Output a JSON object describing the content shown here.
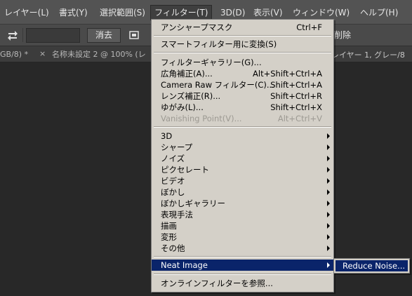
{
  "menubar": {
    "items": [
      {
        "label": "レイヤー(L)"
      },
      {
        "label": "書式(Y)"
      },
      {
        "label": "選択範囲(S)"
      },
      {
        "label": "フィルター(T)"
      },
      {
        "label": "3D(D)"
      },
      {
        "label": "表示(V)"
      },
      {
        "label": "ウィンドウ(W)"
      },
      {
        "label": "ヘルプ(H)"
      }
    ]
  },
  "optionsbar": {
    "clear_label": "消去",
    "right_text": "削除"
  },
  "tabs": {
    "left": "GB/8) *",
    "close": "×",
    "second": "名称未設定 2 @ 100% (レ",
    "right": "レイヤー 1, グレー/8"
  },
  "filter_menu": {
    "items": [
      {
        "label": "アンシャープマスク",
        "shortcut": "Ctrl+F"
      },
      {
        "label": "スマートフィルター用に変換(S)"
      },
      {
        "label": "フィルターギャラリー(G)..."
      },
      {
        "label": "広角補正(A)...",
        "shortcut": "Alt+Shift+Ctrl+A"
      },
      {
        "label": "Camera Raw フィルター(C)...",
        "shortcut": "Shift+Ctrl+A"
      },
      {
        "label": "レンズ補正(R)...",
        "shortcut": "Shift+Ctrl+R"
      },
      {
        "label": "ゆがみ(L)...",
        "shortcut": "Shift+Ctrl+X"
      },
      {
        "label": "Vanishing Point(V)...",
        "shortcut": "Alt+Ctrl+V"
      },
      {
        "label": "3D"
      },
      {
        "label": "シャープ"
      },
      {
        "label": "ノイズ"
      },
      {
        "label": "ピクセレート"
      },
      {
        "label": "ビデオ"
      },
      {
        "label": "ぼかし"
      },
      {
        "label": "ぼかしギャラリー"
      },
      {
        "label": "表現手法"
      },
      {
        "label": "描画"
      },
      {
        "label": "変形"
      },
      {
        "label": "その他"
      },
      {
        "label": "Neat Image"
      },
      {
        "label": "オンラインフィルターを参照..."
      }
    ]
  },
  "submenu": {
    "items": [
      {
        "label": "Reduce Noise..."
      }
    ]
  }
}
